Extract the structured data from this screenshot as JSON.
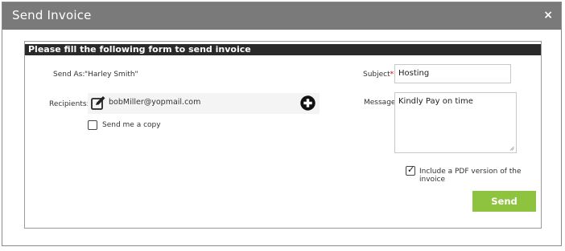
{
  "dialog": {
    "title": "Send Invoice",
    "close_label": "×"
  },
  "form": {
    "header": "Please fill the following form to send invoice",
    "send_as_label": "Send As:",
    "send_as_value": "\"Harley Smith\"",
    "recipients_label": "Recipients:",
    "recipient_email": "bobMiller@yopmail.com",
    "send_copy_label": "Send me a copy",
    "send_copy_checked": false,
    "subject_label": "Subject",
    "subject_required": "*:",
    "subject_value": "Hosting",
    "message_label": "Message:",
    "message_value": "Kindly Pay on time",
    "include_pdf_label": "Include a PDF version of the invoice",
    "include_pdf_checked": true,
    "send_label": "Send"
  },
  "colors": {
    "titlebar": "#7a7a7a",
    "header": "#2a2a2a",
    "send_button": "#8ec33f"
  },
  "icons": [
    "edit-icon",
    "plus-circle-icon",
    "checkmark-icon",
    "resize-grip-icon"
  ]
}
